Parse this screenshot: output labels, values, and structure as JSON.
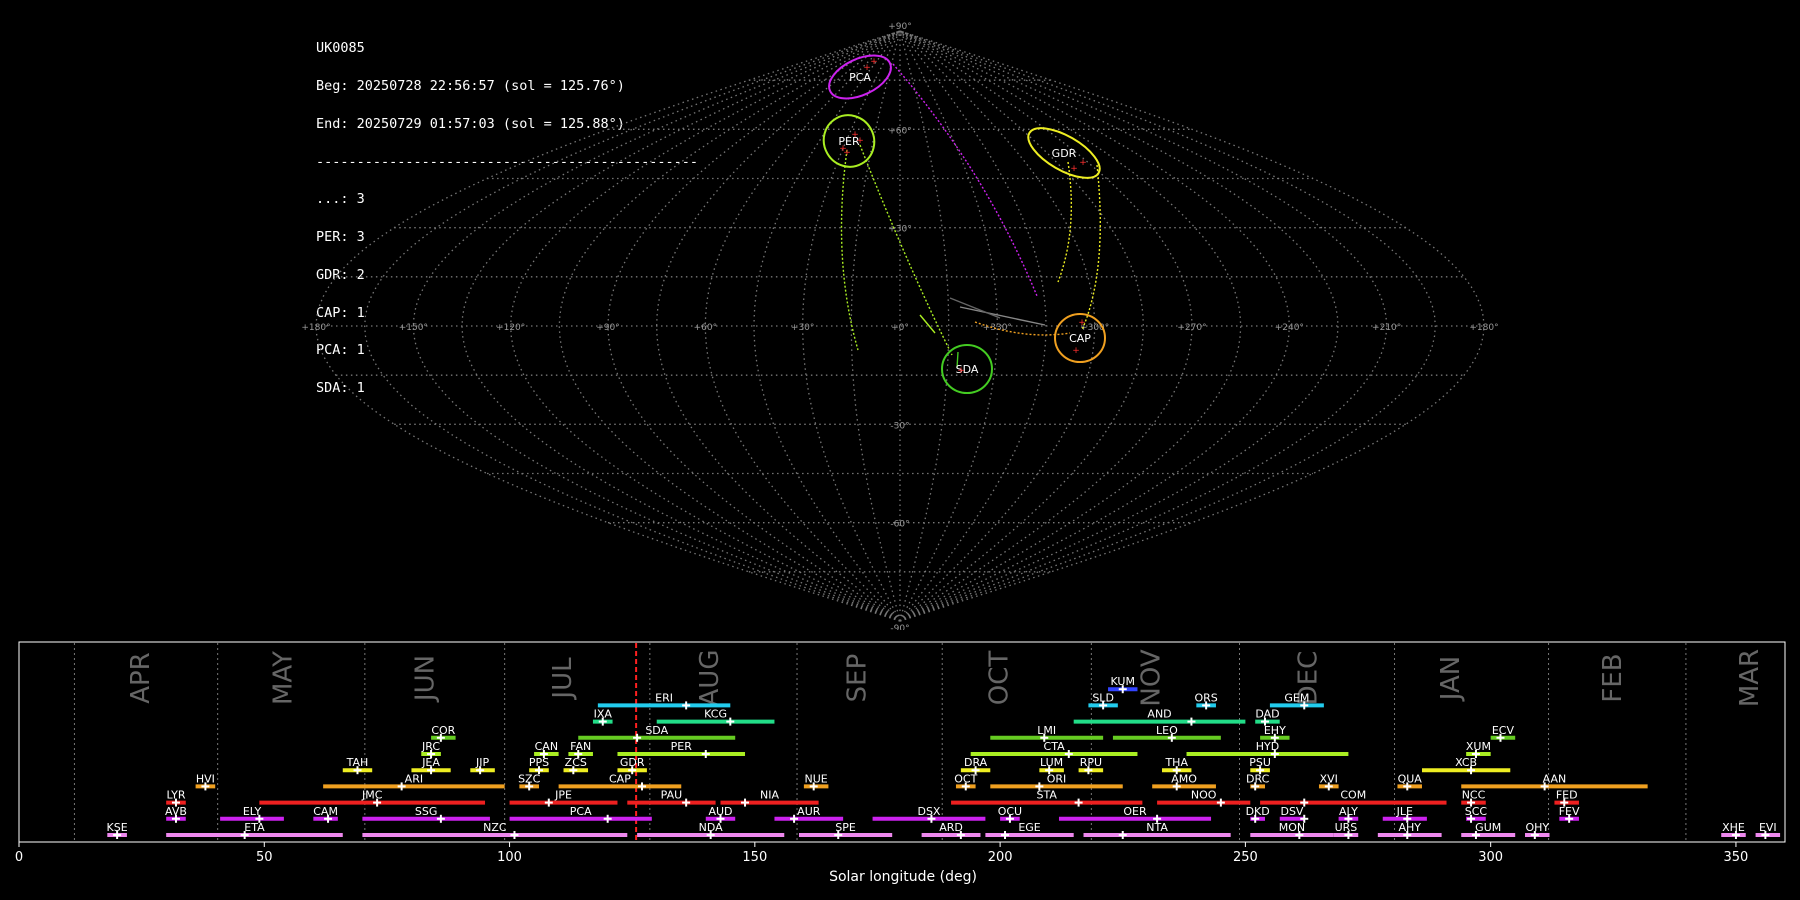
{
  "summary": {
    "station": "UK0085",
    "begin": "Beg: 20250728 22:56:57 (sol = 125.76°)",
    "end": "End: 20250729 01:57:03 (sol = 125.88°)",
    "separator": "-----------------------------------------------",
    "counts": [
      "...: 3",
      "PER: 3",
      "GDR: 2",
      "CAP: 1",
      "PCA: 1",
      "SDA: 1"
    ]
  },
  "sky_map": {
    "lat_labels": [
      "+90°",
      "+60°",
      "+30°",
      "-30°",
      "-60°",
      "-90°"
    ],
    "lon_labels": [
      "+180°",
      "+150°",
      "+120°",
      "+90°",
      "+60°",
      "+30°",
      "+0°",
      "+330°",
      "+300°",
      "+270°",
      "+240°",
      "+210°",
      "+180°"
    ],
    "radiants": [
      {
        "code": "PCA",
        "color": "#cc22ee"
      },
      {
        "code": "PER",
        "color": "#aaee22"
      },
      {
        "code": "GDR",
        "color": "#eeee22"
      },
      {
        "code": "CAP",
        "color": "#f0a020"
      },
      {
        "code": "SDA",
        "color": "#44cc22"
      }
    ]
  },
  "chart_data": {
    "type": "timeline",
    "xlabel": "Solar longitude (deg)",
    "xlim": [
      0,
      360
    ],
    "xticks": [
      0,
      50,
      100,
      150,
      200,
      250,
      300,
      350
    ],
    "current_sol": 125.8,
    "months": [
      {
        "name": "APR",
        "start": 11.3,
        "label_at": 25
      },
      {
        "name": "MAY",
        "start": 40.5,
        "label_at": 54
      },
      {
        "name": "JUN",
        "start": 70.5,
        "label_at": 83
      },
      {
        "name": "JUL",
        "start": 99.0,
        "label_at": 111
      },
      {
        "name": "AUG",
        "start": 128.6,
        "label_at": 141
      },
      {
        "name": "SEP",
        "start": 158.6,
        "label_at": 171
      },
      {
        "name": "OCT",
        "start": 188.2,
        "label_at": 200
      },
      {
        "name": "NOV",
        "start": 218.6,
        "label_at": 231
      },
      {
        "name": "DEC",
        "start": 248.8,
        "label_at": 263
      },
      {
        "name": "JAN",
        "start": 280.4,
        "label_at": 292
      },
      {
        "name": "FEB",
        "start": 311.8,
        "label_at": 325
      },
      {
        "name": "MAR",
        "start": 339.8,
        "label_at": 353
      }
    ],
    "showers": [
      {
        "code": "KUM",
        "start": 222,
        "end": 228,
        "peak": 225,
        "row": 9,
        "color": "#3344ff"
      },
      {
        "code": "ERI",
        "start": 118,
        "end": 145,
        "peak": 136,
        "row": 8,
        "color": "#22ccee"
      },
      {
        "code": "SLD",
        "start": 218,
        "end": 224,
        "peak": 221,
        "row": 8,
        "color": "#22ccee"
      },
      {
        "code": "ORS",
        "start": 240,
        "end": 244,
        "peak": 242,
        "row": 8,
        "color": "#22ccee"
      },
      {
        "code": "GEM",
        "start": 255,
        "end": 266,
        "peak": 262,
        "row": 8,
        "color": "#22ccee"
      },
      {
        "code": "IXA",
        "start": 117,
        "end": 121,
        "peak": 119,
        "row": 7,
        "color": "#22dd88"
      },
      {
        "code": "KCG",
        "start": 130,
        "end": 154,
        "peak": 145,
        "row": 7,
        "color": "#22dd88"
      },
      {
        "code": "AND",
        "start": 215,
        "end": 250,
        "peak": 239,
        "row": 7,
        "color": "#22dd88"
      },
      {
        "code": "DAD",
        "start": 252,
        "end": 257,
        "peak": 254,
        "row": 7,
        "color": "#22dd88"
      },
      {
        "code": "COR",
        "start": 84,
        "end": 89,
        "peak": 86,
        "row": 6,
        "color": "#66cc22"
      },
      {
        "code": "SDA",
        "start": 114,
        "end": 146,
        "peak": 126,
        "row": 6,
        "color": "#66cc22"
      },
      {
        "code": "LMI",
        "start": 198,
        "end": 221,
        "peak": 209,
        "row": 6,
        "color": "#66cc22"
      },
      {
        "code": "LEO",
        "start": 223,
        "end": 245,
        "peak": 235,
        "row": 6,
        "color": "#66cc22"
      },
      {
        "code": "EHY",
        "start": 253,
        "end": 259,
        "peak": 256,
        "row": 6,
        "color": "#66cc22"
      },
      {
        "code": "ECV",
        "start": 300,
        "end": 305,
        "peak": 302,
        "row": 6,
        "color": "#66cc22"
      },
      {
        "code": "JRC",
        "start": 82,
        "end": 86,
        "peak": 84,
        "row": 5,
        "color": "#aaee22"
      },
      {
        "code": "CAN",
        "start": 105,
        "end": 110,
        "peak": 107,
        "row": 5,
        "color": "#aaee22"
      },
      {
        "code": "FAN",
        "start": 112,
        "end": 117,
        "peak": 114,
        "row": 5,
        "color": "#aaee22"
      },
      {
        "code": "PER",
        "start": 122,
        "end": 148,
        "peak": 140,
        "row": 5,
        "color": "#aaee22"
      },
      {
        "code": "CTA",
        "start": 194,
        "end": 228,
        "peak": 214,
        "row": 5,
        "color": "#aaee22"
      },
      {
        "code": "HYD",
        "start": 238,
        "end": 271,
        "peak": 256,
        "row": 5,
        "color": "#aaee22"
      },
      {
        "code": "XUM",
        "start": 295,
        "end": 300,
        "peak": 297,
        "row": 5,
        "color": "#aaee22"
      },
      {
        "code": "TAH",
        "start": 66,
        "end": 72,
        "peak": 69,
        "row": 4,
        "color": "#eeee22"
      },
      {
        "code": "JEA",
        "start": 80,
        "end": 88,
        "peak": 84,
        "row": 4,
        "color": "#eeee22"
      },
      {
        "code": "JIP",
        "start": 92,
        "end": 97,
        "peak": 94,
        "row": 4,
        "color": "#eeee22"
      },
      {
        "code": "PPS",
        "start": 104,
        "end": 108,
        "peak": 106,
        "row": 4,
        "color": "#eeee22"
      },
      {
        "code": "ZCS",
        "start": 111,
        "end": 116,
        "peak": 113,
        "row": 4,
        "color": "#eeee22"
      },
      {
        "code": "GDR",
        "start": 122,
        "end": 128,
        "peak": 125,
        "row": 4,
        "color": "#eeee22"
      },
      {
        "code": "DRA",
        "start": 192,
        "end": 198,
        "peak": 195,
        "row": 4,
        "color": "#eeee22"
      },
      {
        "code": "LUM",
        "start": 208,
        "end": 213,
        "peak": 210,
        "row": 4,
        "color": "#eeee22"
      },
      {
        "code": "RPU",
        "start": 216,
        "end": 221,
        "peak": 218,
        "row": 4,
        "color": "#eeee22"
      },
      {
        "code": "THA",
        "start": 233,
        "end": 239,
        "peak": 236,
        "row": 4,
        "color": "#eeee22"
      },
      {
        "code": "PSU",
        "start": 251,
        "end": 255,
        "peak": 253,
        "row": 4,
        "color": "#eeee22"
      },
      {
        "code": "XCB",
        "start": 286,
        "end": 304,
        "peak": 296,
        "row": 4,
        "color": "#eeee22"
      },
      {
        "code": "HVI",
        "start": 36,
        "end": 40,
        "peak": 38,
        "row": 3,
        "color": "#f0a020"
      },
      {
        "code": "ARI",
        "start": 62,
        "end": 99,
        "peak": 78,
        "row": 3,
        "color": "#f0a020"
      },
      {
        "code": "SZC",
        "start": 102,
        "end": 106,
        "peak": 104,
        "row": 3,
        "color": "#f0a020"
      },
      {
        "code": "CAP",
        "start": 110,
        "end": 135,
        "peak": 127,
        "row": 3,
        "color": "#f0a020"
      },
      {
        "code": "NUE",
        "start": 160,
        "end": 165,
        "peak": 162,
        "row": 3,
        "color": "#f0a020"
      },
      {
        "code": "OCT",
        "start": 191,
        "end": 195,
        "peak": 193,
        "row": 3,
        "color": "#f0a020"
      },
      {
        "code": "ORI",
        "start": 198,
        "end": 225,
        "peak": 208,
        "row": 3,
        "color": "#f0a020"
      },
      {
        "code": "AMO",
        "start": 231,
        "end": 244,
        "peak": 236,
        "row": 3,
        "color": "#f0a020"
      },
      {
        "code": "DRC",
        "start": 251,
        "end": 254,
        "peak": 252,
        "row": 3,
        "color": "#f0a020"
      },
      {
        "code": "XVI",
        "start": 265,
        "end": 269,
        "peak": 267,
        "row": 3,
        "color": "#f0a020"
      },
      {
        "code": "QUA",
        "start": 281,
        "end": 286,
        "peak": 283,
        "row": 3,
        "color": "#f0a020"
      },
      {
        "code": "AAN",
        "start": 294,
        "end": 332,
        "peak": 311,
        "row": 3,
        "color": "#f0a020"
      },
      {
        "code": "LYR",
        "start": 30,
        "end": 34,
        "peak": 32,
        "row": 2,
        "color": "#ee2020"
      },
      {
        "code": "JMC",
        "start": 49,
        "end": 95,
        "peak": 73,
        "row": 2,
        "color": "#ee2020"
      },
      {
        "code": "JPE",
        "start": 100,
        "end": 122,
        "peak": 108,
        "row": 2,
        "color": "#ee2020"
      },
      {
        "code": "PAU",
        "start": 124,
        "end": 142,
        "peak": 136,
        "row": 2,
        "color": "#ee2020"
      },
      {
        "code": "NIA",
        "start": 143,
        "end": 163,
        "peak": 148,
        "row": 2,
        "color": "#ee2020"
      },
      {
        "code": "STA",
        "start": 190,
        "end": 229,
        "peak": 216,
        "row": 2,
        "color": "#ee2020"
      },
      {
        "code": "NOO",
        "start": 232,
        "end": 251,
        "peak": 245,
        "row": 2,
        "color": "#ee2020"
      },
      {
        "code": "COM",
        "start": 253,
        "end": 291,
        "peak": 262,
        "row": 2,
        "color": "#ee2020"
      },
      {
        "code": "NCC",
        "start": 294,
        "end": 299,
        "peak": 296,
        "row": 2,
        "color": "#ee2020"
      },
      {
        "code": "FED",
        "start": 313,
        "end": 318,
        "peak": 315,
        "row": 2,
        "color": "#ee2020"
      },
      {
        "code": "AVB",
        "start": 30,
        "end": 34,
        "peak": 32,
        "row": 1,
        "color": "#cc22ee"
      },
      {
        "code": "ELY",
        "start": 41,
        "end": 54,
        "peak": 49,
        "row": 1,
        "color": "#cc22ee"
      },
      {
        "code": "CAM",
        "start": 60,
        "end": 65,
        "peak": 63,
        "row": 1,
        "color": "#cc22ee"
      },
      {
        "code": "SSG",
        "start": 70,
        "end": 96,
        "peak": 86,
        "row": 1,
        "color": "#cc22ee"
      },
      {
        "code": "PCA",
        "start": 100,
        "end": 129,
        "peak": 120,
        "row": 1,
        "color": "#cc22ee"
      },
      {
        "code": "AUD",
        "start": 140,
        "end": 146,
        "peak": 143,
        "row": 1,
        "color": "#cc22ee"
      },
      {
        "code": "AUR",
        "start": 154,
        "end": 168,
        "peak": 158,
        "row": 1,
        "color": "#cc22ee"
      },
      {
        "code": "DSX",
        "start": 174,
        "end": 197,
        "peak": 186,
        "row": 1,
        "color": "#cc22ee"
      },
      {
        "code": "OCU",
        "start": 200,
        "end": 204,
        "peak": 202,
        "row": 1,
        "color": "#cc22ee"
      },
      {
        "code": "OER",
        "start": 212,
        "end": 243,
        "peak": 232,
        "row": 1,
        "color": "#cc22ee"
      },
      {
        "code": "DKD",
        "start": 251,
        "end": 254,
        "peak": 252,
        "row": 1,
        "color": "#cc22ee"
      },
      {
        "code": "DSV",
        "start": 257,
        "end": 262,
        "peak": 262,
        "row": 1,
        "color": "#cc22ee"
      },
      {
        "code": "ALY",
        "start": 269,
        "end": 273,
        "peak": 271,
        "row": 1,
        "color": "#cc22ee"
      },
      {
        "code": "JLE",
        "start": 278,
        "end": 287,
        "peak": 283,
        "row": 1,
        "color": "#cc22ee"
      },
      {
        "code": "SCC",
        "start": 295,
        "end": 299,
        "peak": 296,
        "row": 1,
        "color": "#cc22ee"
      },
      {
        "code": "FEV",
        "start": 314,
        "end": 318,
        "peak": 316,
        "row": 1,
        "color": "#cc22ee"
      },
      {
        "code": "KSE",
        "start": 18,
        "end": 22,
        "peak": 20,
        "row": 0,
        "color": "#ee88ee"
      },
      {
        "code": "ETA",
        "start": 30,
        "end": 66,
        "peak": 46,
        "row": 0,
        "color": "#ee88ee"
      },
      {
        "code": "NZC",
        "start": 70,
        "end": 124,
        "peak": 101,
        "row": 0,
        "color": "#ee88ee"
      },
      {
        "code": "NDA",
        "start": 126,
        "end": 156,
        "peak": 141,
        "row": 0,
        "color": "#ee88ee"
      },
      {
        "code": "SPE",
        "start": 159,
        "end": 178,
        "peak": 167,
        "row": 0,
        "color": "#ee88ee"
      },
      {
        "code": "ARD",
        "start": 184,
        "end": 196,
        "peak": 192,
        "row": 0,
        "color": "#ee88ee"
      },
      {
        "code": "EGE",
        "start": 197,
        "end": 215,
        "peak": 201,
        "row": 0,
        "color": "#ee88ee"
      },
      {
        "code": "NTA",
        "start": 217,
        "end": 247,
        "peak": 225,
        "row": 0,
        "color": "#ee88ee"
      },
      {
        "code": "MON",
        "start": 251,
        "end": 268,
        "peak": 261,
        "row": 0,
        "color": "#ee88ee"
      },
      {
        "code": "URS",
        "start": 268,
        "end": 273,
        "peak": 271,
        "row": 0,
        "color": "#ee88ee"
      },
      {
        "code": "AHY",
        "start": 277,
        "end": 290,
        "peak": 283,
        "row": 0,
        "color": "#ee88ee"
      },
      {
        "code": "GUM",
        "start": 294,
        "end": 305,
        "peak": 297,
        "row": 0,
        "color": "#ee88ee"
      },
      {
        "code": "OHY",
        "start": 307,
        "end": 312,
        "peak": 309,
        "row": 0,
        "color": "#ee88ee"
      },
      {
        "code": "XHE",
        "start": 347,
        "end": 352,
        "peak": 350,
        "row": 0,
        "color": "#ee88ee"
      },
      {
        "code": "EVI",
        "start": 354,
        "end": 359,
        "peak": 356,
        "row": 0,
        "color": "#ee88ee"
      }
    ]
  }
}
